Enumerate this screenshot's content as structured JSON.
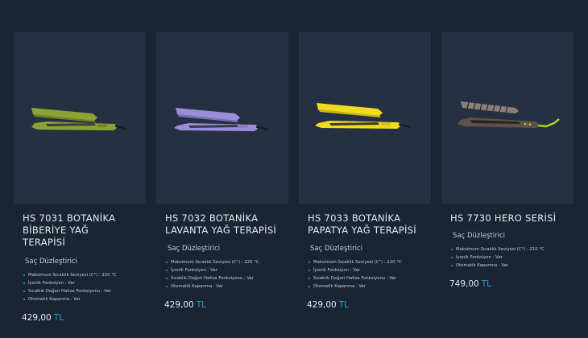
{
  "products": [
    {
      "title_lines": [
        "HS 7031 BOTANİKA",
        "BİBERİYE YAĞ",
        "TERAPİSİ"
      ],
      "category": "Saç Düzleştirici",
      "specs": [
        "Maksimum Sıcaklık Seviyesi (C°) : 220 °C",
        "İyonik Fonksiyon : Var",
        "Sıcaklık Değeri Hafıza Fonksiyonu : Var",
        "Otomatik Kapanma : Var"
      ],
      "price": "429,00",
      "currency": "TL",
      "color": "#8da234",
      "icon": "hair-straightener-green"
    },
    {
      "title_lines": [
        "HS 7032 BOTANİKA",
        "LAVANTA YAĞ TERAPİSİ"
      ],
      "category": "Saç Düzleştirici",
      "specs": [
        "Maksimum Sıcaklık Seviyesi (C°) : 220 °C",
        "İyonik Fonksiyon : Var",
        "Sıcaklık Değeri Hafıza Fonksiyonu : Var",
        "Otomatik Kapanma : Var"
      ],
      "price": "429,00",
      "currency": "TL",
      "color": "#9b8ed8",
      "icon": "hair-straightener-lavender"
    },
    {
      "title_lines": [
        "HS 7033 BOTANİKA",
        "PAPATYA YAĞ TERAPİSİ"
      ],
      "category": "Saç Düzleştirici",
      "specs": [
        "Maksimum Sıcaklık Seviyesi (C°) : 220 °C",
        "İyonik Fonksiyon : Var",
        "Sıcaklık Değeri Hafıza Fonksiyonu : Var",
        "Otomatik Kapanma : Var"
      ],
      "price": "429,00",
      "currency": "TL",
      "color": "#f0dc1c",
      "icon": "hair-straightener-yellow"
    },
    {
      "title_lines": [
        "HS 7730 HERO SERİSİ"
      ],
      "category": "Saç Düzleştirici",
      "specs": [
        "Maksimum Sıcaklık Seviyesi (C°) : 210 °C",
        "İyonik Fonksiyon : Var",
        "Otomatik Kapanma : Var"
      ],
      "price": "749,00",
      "currency": "TL",
      "color": "#6d5f58",
      "icon": "hair-straightener-hero"
    }
  ]
}
